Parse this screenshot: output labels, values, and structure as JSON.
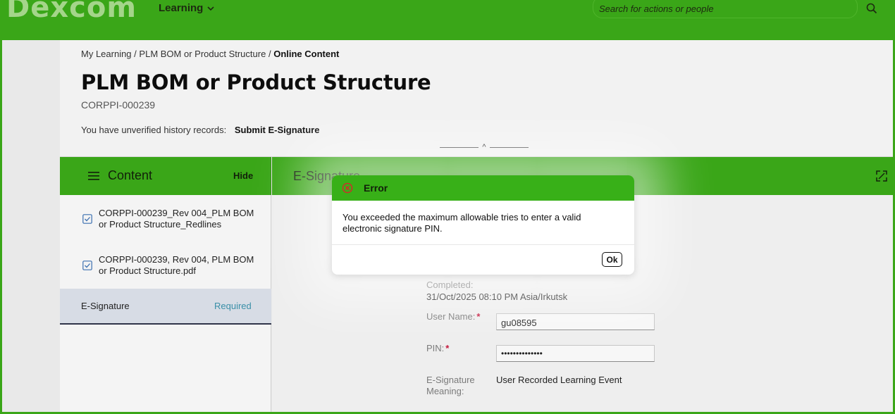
{
  "header": {
    "logo_text": "Dexcom",
    "nav_learning": "Learning",
    "search_placeholder": "Search for actions or people"
  },
  "breadcrumb": {
    "item1": "My Learning",
    "sep": "/",
    "item2": "PLM BOM or Product Structure",
    "current": "Online Content"
  },
  "page": {
    "title": "PLM BOM or Product Structure",
    "code": "CORPPI-000239",
    "unverified_text": "You have unverified history records:",
    "submit_link": "Submit E-Signature"
  },
  "content_panel": {
    "title": "Content",
    "hide_label": "Hide",
    "items": [
      {
        "label": "CORPPI-000239_Rev 004_PLM BOM or Product Structure_Redlines"
      },
      {
        "label": "CORPPI-000239, Rev 004, PLM BOM or Product Structure.pdf"
      }
    ],
    "esig_item": {
      "label": "E-Signature",
      "status": "Required"
    }
  },
  "esig_panel": {
    "title": "E-Signature",
    "completed_label": "Completed:",
    "completed_value": "31/Oct/2025 08:10 PM Asia/Irkutsk",
    "username_label": "User Name:",
    "username_value": "gu08595",
    "pin_label": "PIN:",
    "pin_value": "••••••••••••••",
    "meaning_label_1": "E-Signature",
    "meaning_label_2": "Meaning:",
    "meaning_value": "User Recorded Learning Event",
    "required_mark": "*"
  },
  "dialog": {
    "title": "Error",
    "message": "You exceeded the maximum allowable tries to enter a valid electronic signature PIN.",
    "ok_label": "Ok"
  },
  "colors": {
    "brand_green": "#3aa618",
    "dialog_header": "#38b018",
    "error_red": "#d22a2a",
    "required_red": "#c4163b",
    "status_teal": "#3a8fa8"
  },
  "icons": {
    "nav": "chevron-down-icon",
    "search": "search-icon",
    "menu": "menu-icon",
    "item_status": "checkbox-icon",
    "expand": "expand-icon",
    "error": "error-circle-icon",
    "collapse": "caret-up-icon"
  }
}
